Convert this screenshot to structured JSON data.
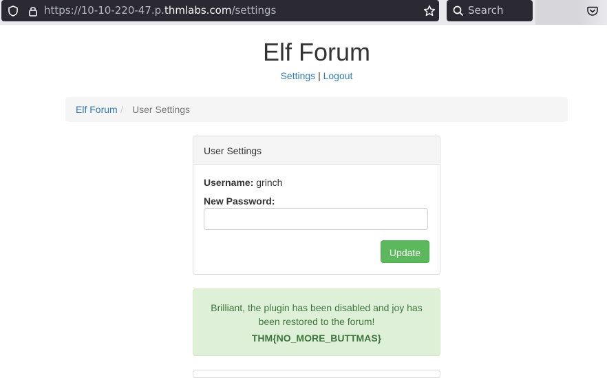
{
  "browser": {
    "url_prefix": "https://10-10-220-47.p.",
    "url_host": "thmlabs.com",
    "url_path": "/settings",
    "search_placeholder": "Search"
  },
  "site": {
    "title": "Elf Forum",
    "nav": {
      "settings": "Settings",
      "separator": "|",
      "logout": "Logout"
    }
  },
  "breadcrumb": {
    "home": "Elf Forum",
    "separator": "/",
    "current": "User Settings"
  },
  "settings_panel": {
    "heading": "User Settings",
    "username_label": "Username:",
    "username_value": "grinch",
    "password_label": "New Password:",
    "password_value": "",
    "update_button": "Update"
  },
  "alert": {
    "message": "Brilliant, the plugin has been disabled and joy has been restored to the forum!",
    "flag": "THM{NO_MORE_BUTTMAS}"
  },
  "colors": {
    "link": "#337ab7",
    "success_button": "#5cb85c",
    "alert_bg": "#dff0d8",
    "alert_text": "#3c763d"
  }
}
